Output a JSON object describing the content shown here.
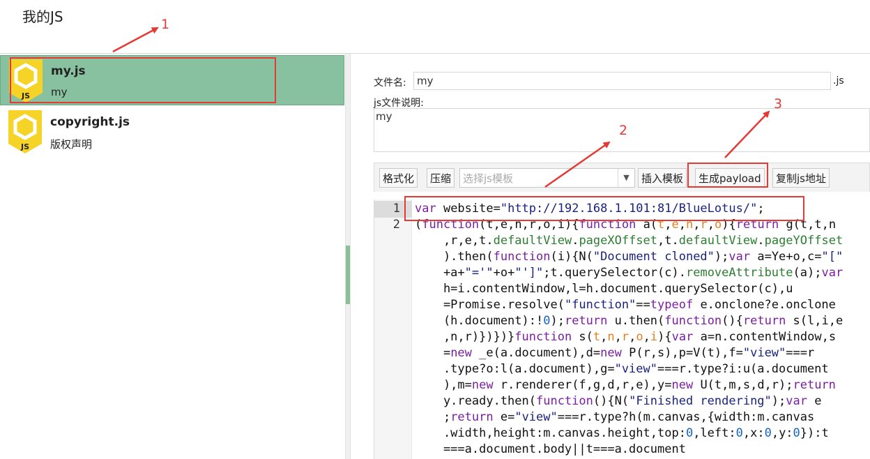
{
  "page": {
    "title": "我的JS"
  },
  "js_list": [
    {
      "name": "my.js",
      "desc": "my",
      "selected": true
    },
    {
      "name": "copyright.js",
      "desc": "版权声明",
      "selected": false
    }
  ],
  "icon": {
    "badge": "JS",
    "name": "js-file-icon"
  },
  "form": {
    "filename_label": "文件名:",
    "filename_value": "my",
    "filename_ext": ".js",
    "desc_label": "js文件说明:",
    "desc_value": "my"
  },
  "toolbar": {
    "format": "格式化",
    "compress": "压缩",
    "template_placeholder": "选择js模板",
    "insert_template": "插入模板",
    "generate_payload": "生成payload",
    "copy_url": "复制js地址"
  },
  "editor": {
    "line_numbers": [
      "1",
      "2"
    ]
  },
  "annotations": [
    "1",
    "2",
    "3"
  ],
  "colors": {
    "selected_bg": "#88c19f",
    "annotation": "#e53935"
  }
}
